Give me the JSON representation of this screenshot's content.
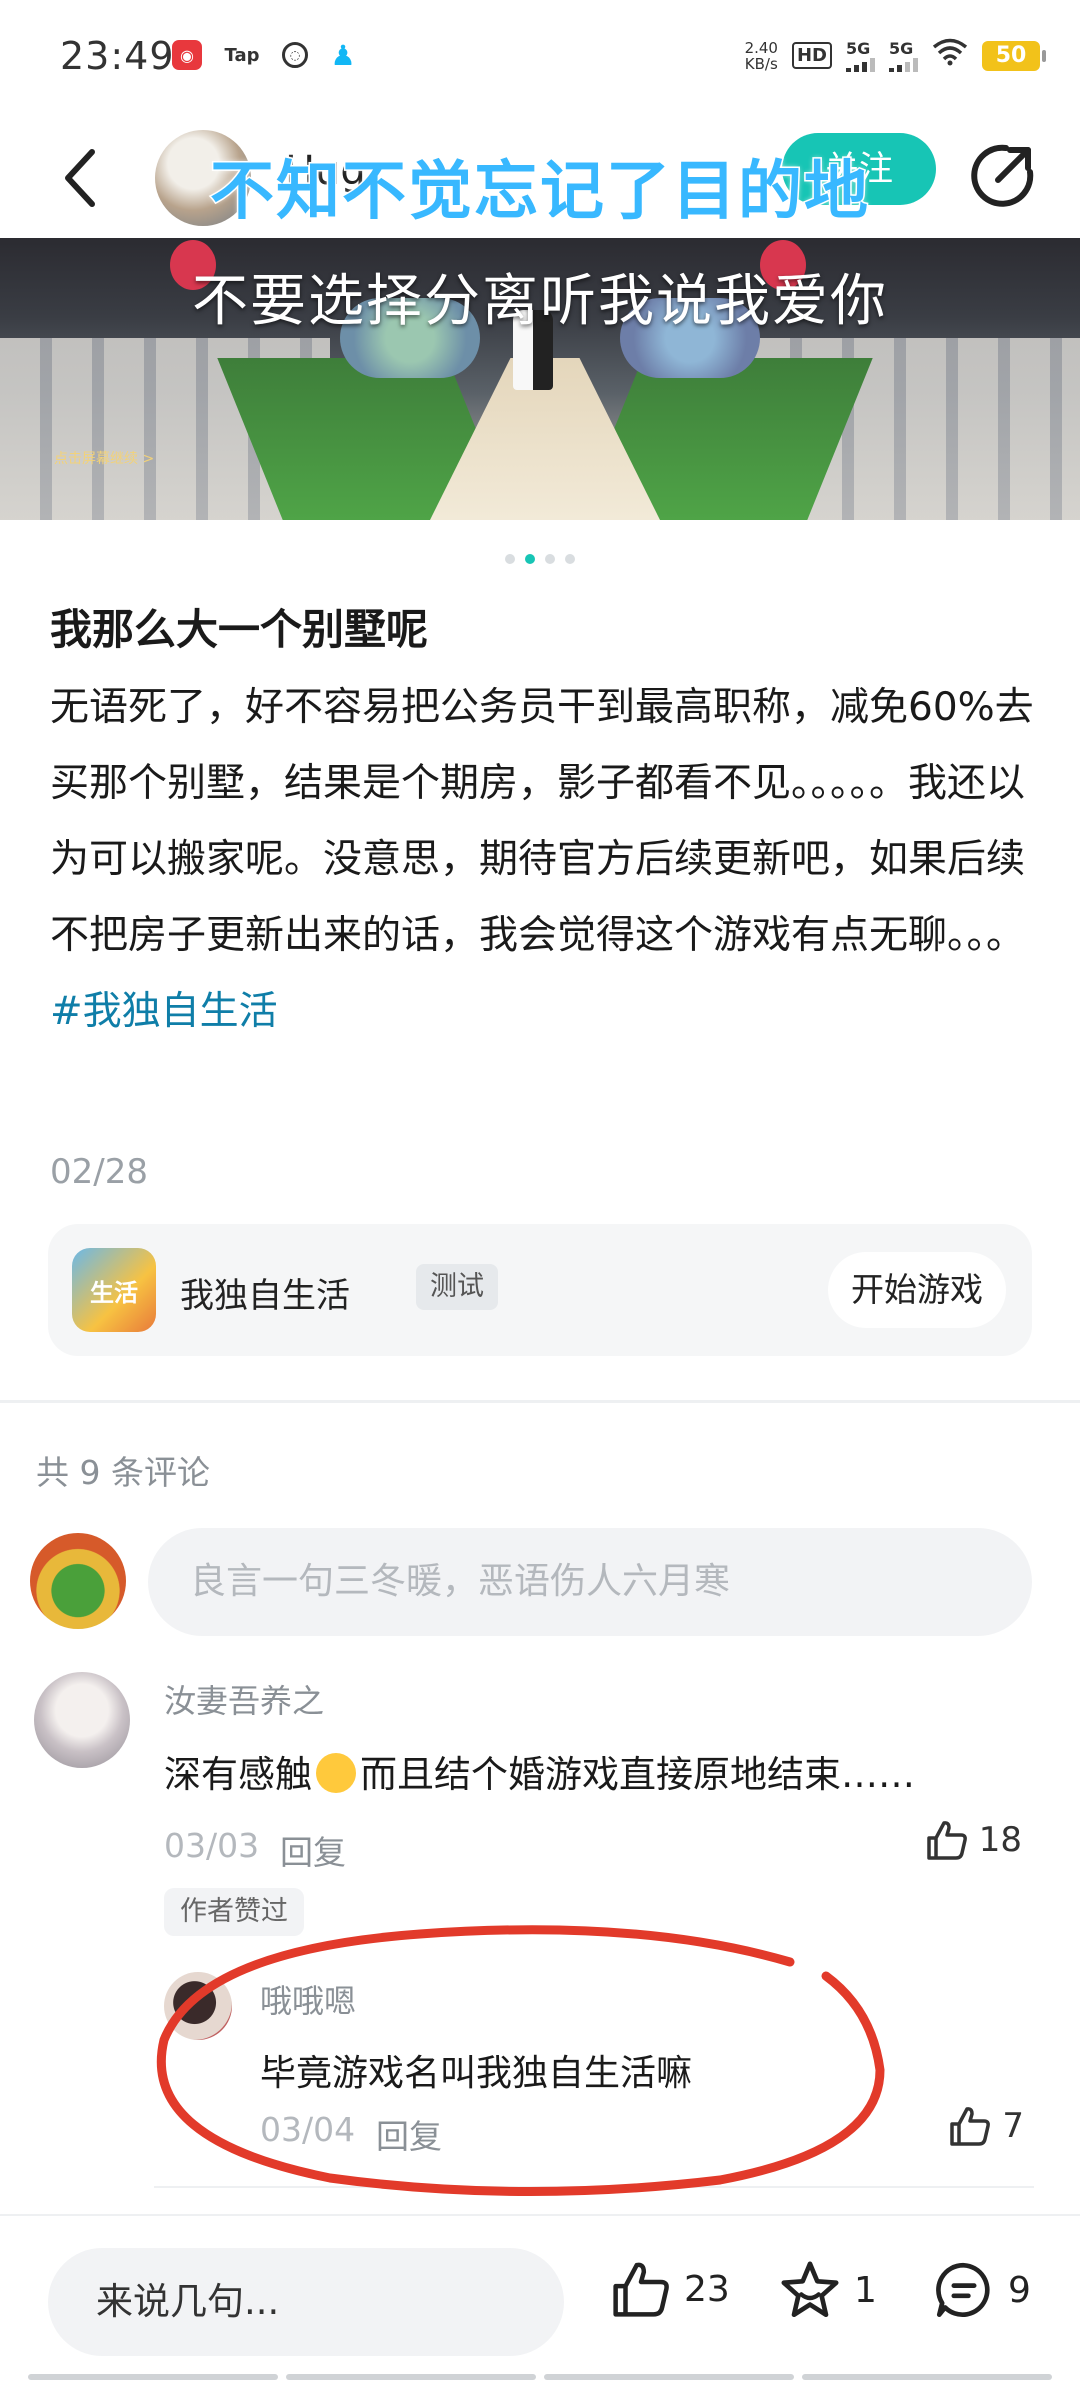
{
  "status_bar": {
    "time": "23:49",
    "apps": [
      "netease-music-icon",
      "taptap-icon",
      "ring-icon",
      "qq-icon"
    ],
    "tap_label": "Tap",
    "net_speed": "2.40",
    "net_unit": "KB/s",
    "hd_label": "HD",
    "signal_1": "5G",
    "signal_2": "5G",
    "battery": "50"
  },
  "nav": {
    "username": "Hug",
    "follow_label": "关注",
    "overlay_title": "不知不觉忘记了目的地"
  },
  "banner": {
    "caption": "不要选择分离听我说我爱你",
    "small_text": "点击屏幕继续 >",
    "page_count": 4,
    "active_page": 1
  },
  "post": {
    "title": "我那么大一个别墅呢",
    "body": "无语死了，好不容易把公务员干到最高职称，减免60%去买那个别墅，结果是个期房，影子都看不见。。。。。我还以为可以搬家呢。没意思，期待官方后续更新吧，如果后续不把房子更新出来的话，我会觉得这个游戏有点无聊。。。",
    "tag": "#我独自生活",
    "date": "02/28"
  },
  "game_card": {
    "icon_text": "生活",
    "name": "我独自生活",
    "badge": "测试",
    "play_label": "开始游戏"
  },
  "comments": {
    "count_label": "共 9 条评论",
    "input_placeholder": "良言一句三冬暖，恶语伤人六月寒",
    "items": [
      {
        "user": "汝妻吾养之",
        "text_before": "深有感触",
        "text_after": "而且结个婚游戏直接原地结束……",
        "date": "03/03",
        "reply_label": "回复",
        "likes": "18",
        "author_liked": "作者赞过",
        "replies": [
          {
            "user": "哦哦嗯",
            "text": "毕竟游戏名叫我独自生活嘛",
            "date": "03/04",
            "reply_label": "回复",
            "likes": "7"
          }
        ]
      }
    ]
  },
  "bottom_bar": {
    "input_placeholder": "来说几句...",
    "likes": "23",
    "favorites": "1",
    "comments": "9"
  },
  "colors": {
    "accent": "#17c5b5",
    "tag": "#0f7ea8",
    "annotation": "#e23a2a",
    "overlay_text": "#38b8ff"
  }
}
